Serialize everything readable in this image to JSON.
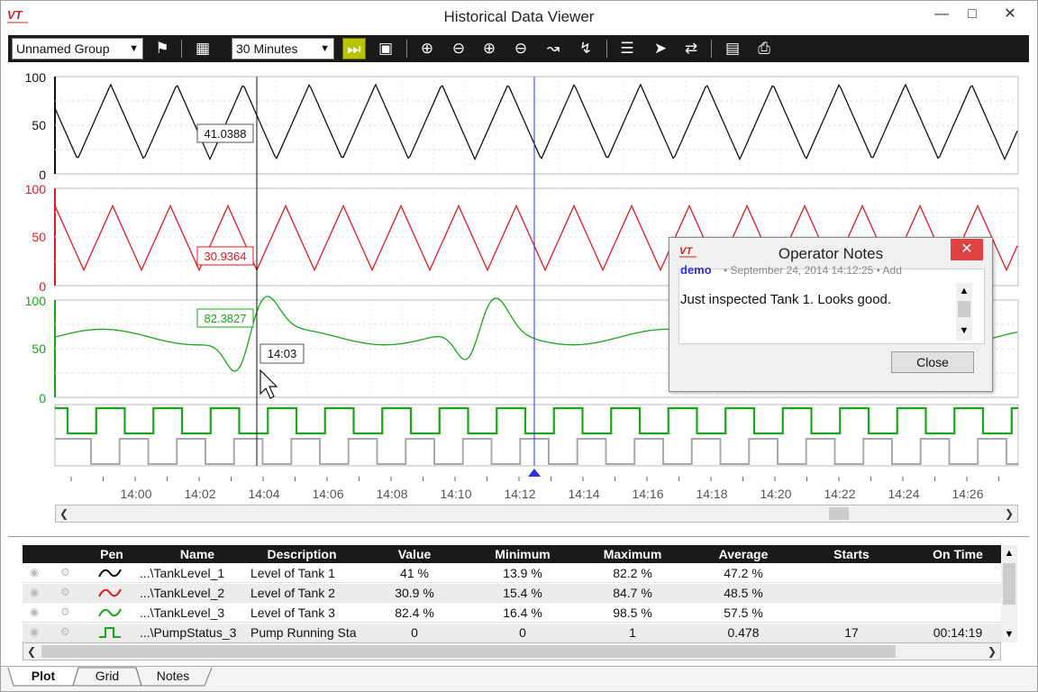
{
  "window": {
    "title": "Historical Data Viewer",
    "logo_text": "VT"
  },
  "toolbar": {
    "group_select": "Unnamed Group",
    "time_select": "30 Minutes",
    "icons": [
      "tag-icon",
      "save-icon",
      "play-live-icon",
      "calendar-icon",
      "zoom-in-icon",
      "zoom-out-icon",
      "zoom-in-time-icon",
      "zoom-out-time-icon",
      "auto-scale-icon",
      "value-axis-icon",
      "legend-icon",
      "cursor-icon",
      "pan-icon",
      "notes-icon",
      "print-icon"
    ]
  },
  "plots": {
    "y_ticks": [
      "100",
      "50",
      "0"
    ],
    "x_ticks": [
      "14:00",
      "14:02",
      "14:04",
      "14:06",
      "14:08",
      "14:10",
      "14:12",
      "14:14",
      "14:16",
      "14:18",
      "14:20",
      "14:22",
      "14:24",
      "14:26"
    ],
    "cursor_values": [
      "41.0388",
      "30.9364",
      "82.3827"
    ],
    "cursor_time": "14:03",
    "colors": {
      "pen1": "#111111",
      "pen2": "#e8191e",
      "pen3": "#1aa51a",
      "pen4": "#1aa51a",
      "pen5": "#a0a0a0",
      "marker": "#2b32e0"
    }
  },
  "notes": {
    "title": "Operator Notes",
    "logo_text": "VT",
    "user": "demo",
    "meta": "• September 24, 2014 14:12:25  • Add",
    "text": "Just inspected Tank 1. Looks good.",
    "close_label": "Close"
  },
  "grid": {
    "headers": {
      "pen": "Pen",
      "name": "Name",
      "description": "Description",
      "value": "Value",
      "minimum": "Minimum",
      "maximum": "Maximum",
      "average": "Average",
      "starts": "Starts",
      "ontime": "On Time"
    },
    "rows": [
      {
        "name": "...\\TankLevel_1",
        "description": "Level of Tank 1",
        "value": "41 %",
        "minimum": "13.9 %",
        "maximum": "82.2 %",
        "average": "47.2 %",
        "starts": "",
        "ontime": ""
      },
      {
        "name": "...\\TankLevel_2",
        "description": "Level of Tank 2",
        "value": "30.9 %",
        "minimum": "15.4 %",
        "maximum": "84.7 %",
        "average": "48.5 %",
        "starts": "",
        "ontime": ""
      },
      {
        "name": "...\\TankLevel_3",
        "description": "Level of Tank 3",
        "value": "82.4 %",
        "minimum": "16.4 %",
        "maximum": "98.5 %",
        "average": "57.5 %",
        "starts": "",
        "ontime": ""
      },
      {
        "name": "...\\PumpStatus_3",
        "description": "Pump Running Sta",
        "value": "0",
        "minimum": "0",
        "maximum": "1",
        "average": "0.478",
        "starts": "17",
        "ontime": "00:14:19"
      }
    ]
  },
  "tabs": [
    "Plot",
    "Grid",
    "Notes"
  ]
}
